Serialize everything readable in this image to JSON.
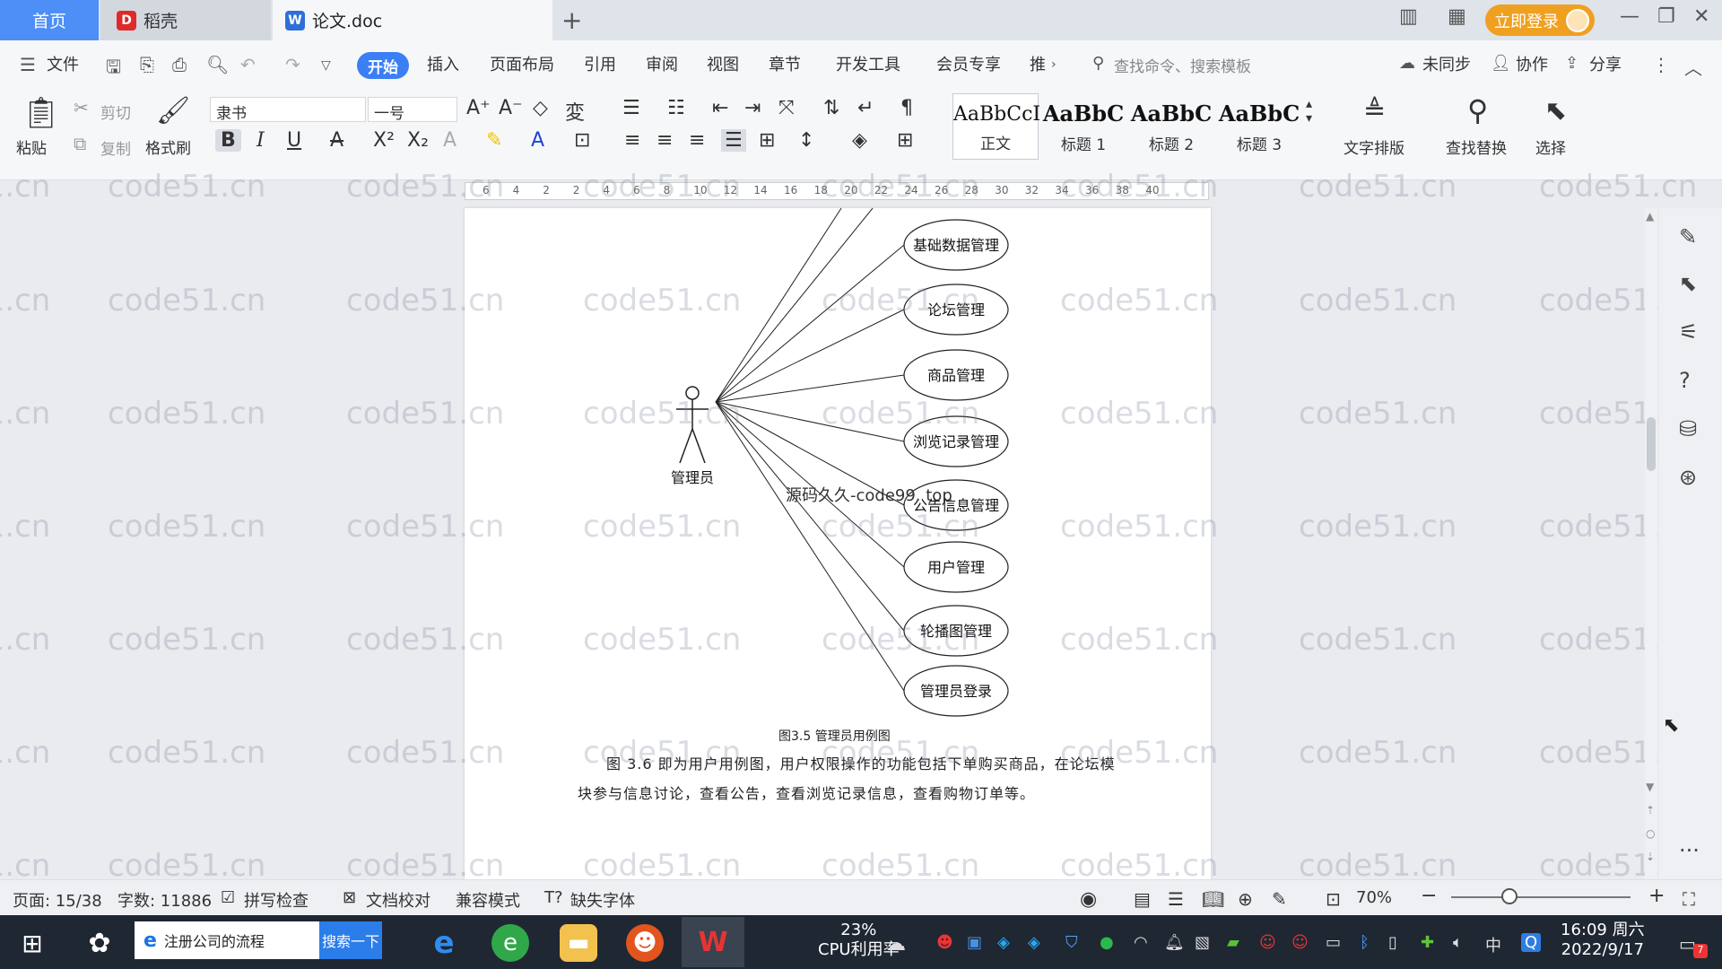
{
  "tabs": {
    "home": "首页",
    "daoke": "稻壳",
    "doc": "论文.doc"
  },
  "title_bar": {
    "login": "立即登录"
  },
  "menu": {
    "file": "文件",
    "items": [
      "开始",
      "插入",
      "页面布局",
      "引用",
      "审阅",
      "视图",
      "章节",
      "开发工具",
      "会员专享",
      "推"
    ],
    "search": "查找命令、搜索模板",
    "sync": "未同步",
    "collab": "协作",
    "share": "分享"
  },
  "ribbon": {
    "paste": "粘贴",
    "cut": "剪切",
    "copy": "复制",
    "format_painter": "格式刷",
    "font_name": "隶书",
    "font_size": "一号",
    "styles": [
      {
        "sample": "AaBbCcI",
        "name": "正文"
      },
      {
        "sample": "AaBbC",
        "name": "标题 1"
      },
      {
        "sample": "AaBbC",
        "name": "标题 2"
      },
      {
        "sample": "AaBbC",
        "name": "标题 3"
      }
    ],
    "text_layout": "文字排版",
    "find_replace": "查找替换",
    "select": "选择"
  },
  "ruler": {
    "ticks": [
      "6",
      "4",
      "2",
      "2",
      "4",
      "6",
      "8",
      "10",
      "12",
      "14",
      "16",
      "18",
      "20",
      "22",
      "24",
      "26",
      "28",
      "30",
      "32",
      "34",
      "36",
      "38",
      "40"
    ]
  },
  "diagram": {
    "actor": "管理员",
    "use_cases": [
      "基础数据管理",
      "论坛管理",
      "商品管理",
      "浏览记录管理",
      "公告信息管理",
      "用户管理",
      "轮播图管理",
      "管理员登录"
    ]
  },
  "document": {
    "overlay_text": "源码久久-code99. top",
    "caption": "图3.5 管理员用例图",
    "paragraph_line1": "图 3.6 即为用户用例图，用户权限操作的功能包括下单购买商品，在论坛模",
    "paragraph_line2": "块参与信息讨论，查看公告，查看浏览记录信息，查看购物订单等。"
  },
  "watermark": "code51.cn",
  "status": {
    "page": "页面: 15/38",
    "words": "字数: 11886",
    "spell": "拼写检查",
    "proofread": "文档校对",
    "compat": "兼容模式",
    "missing_font": "缺失字体",
    "zoom": "70%"
  },
  "taskbar": {
    "search_text": "注册公司的流程",
    "search_btn": "搜索一下",
    "cpu_percent": "23%",
    "cpu_label": "CPU利用率",
    "ime": "中",
    "time": "16:09 周六",
    "date": "2022/9/17",
    "notif_count": "7"
  }
}
